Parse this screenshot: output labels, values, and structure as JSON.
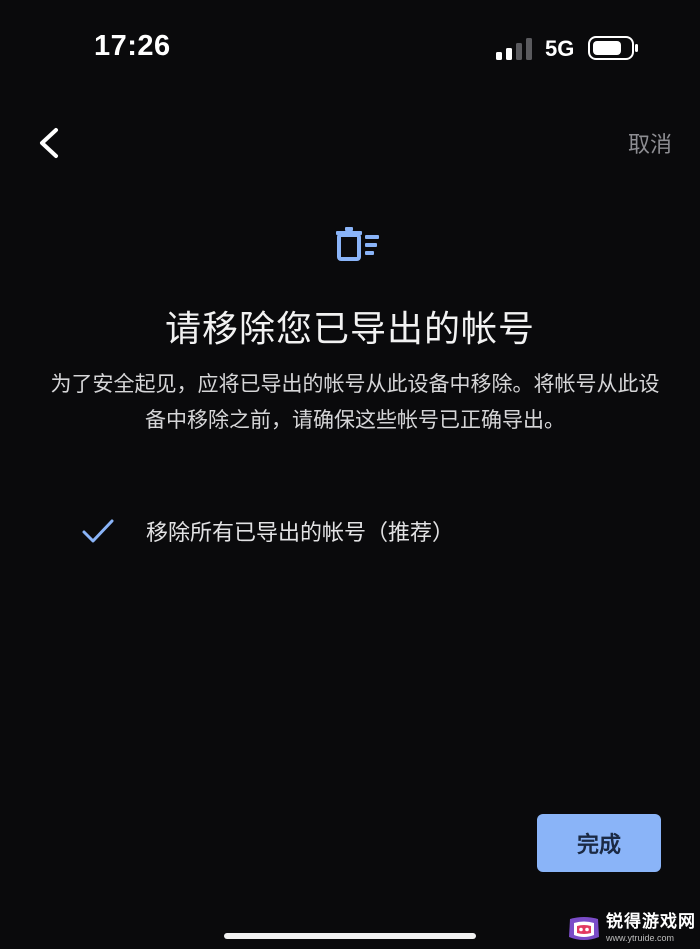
{
  "status_bar": {
    "time": "17:26",
    "network": "5G",
    "signal_bars_active": 2,
    "signal_bars_total": 4
  },
  "nav": {
    "back_icon": "chevron-left-icon",
    "cancel_label": "取消"
  },
  "main": {
    "icon": "delete-list-icon",
    "title": "请移除您已导出的帐号",
    "description": "为了安全起见，应将已导出的帐号从此设备中移除。将帐号从此设备中移除之前，请确保这些帐号已正确导出。",
    "option": {
      "icon": "check-icon",
      "checked": true,
      "label": "移除所有已导出的帐号（推荐）"
    },
    "done_label": "完成"
  },
  "watermark": {
    "title": "锐得游戏网",
    "url": "www.ytruide.com"
  },
  "colors": {
    "background": "#0a0a0c",
    "accent": "#8ab4f8",
    "muted": "#8d8d92"
  }
}
